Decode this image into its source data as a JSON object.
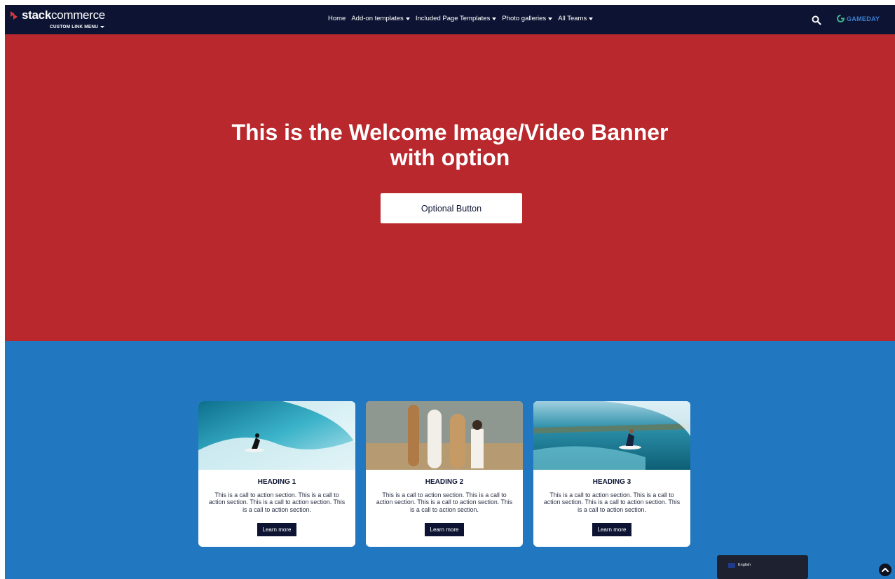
{
  "navbar": {
    "brand_bold": "stack",
    "brand_light": "commerce",
    "custom_menu_label": "CUSTOM LINK MENU",
    "links": [
      {
        "label": "Home"
      },
      {
        "label": "Add-on templates"
      },
      {
        "label": "Included Page Templates"
      },
      {
        "label": "Photo galleries"
      },
      {
        "label": "All Teams"
      }
    ],
    "search_icon": "search-icon",
    "partner_logo": "GAMEDAY"
  },
  "hero": {
    "title_line1": "This is the Welcome Image/Video Banner",
    "title_line2": "with option",
    "button_label": "Optional Button",
    "background_color": "#b8282d"
  },
  "cards_section": {
    "background_color": "#2177c0",
    "cards": [
      {
        "heading": "HEADING 1",
        "text": "This is a call to action section. This is a call to action section. This is a call to action section. This is a call to action section.",
        "button": "Learn more"
      },
      {
        "heading": "HEADING 2",
        "text": "This is a call to action section. This is a call to action section. This is a call to action section. This is a call to action section.",
        "button": "Learn more"
      },
      {
        "heading": "HEADING 3",
        "text": "This is a call to action section. This is a call to action section. This is a call to action section. This is a call to action section.",
        "button": "Learn more"
      }
    ]
  },
  "language_selector": {
    "label": "English"
  },
  "scroll_top_icon": "chevron-up-icon"
}
